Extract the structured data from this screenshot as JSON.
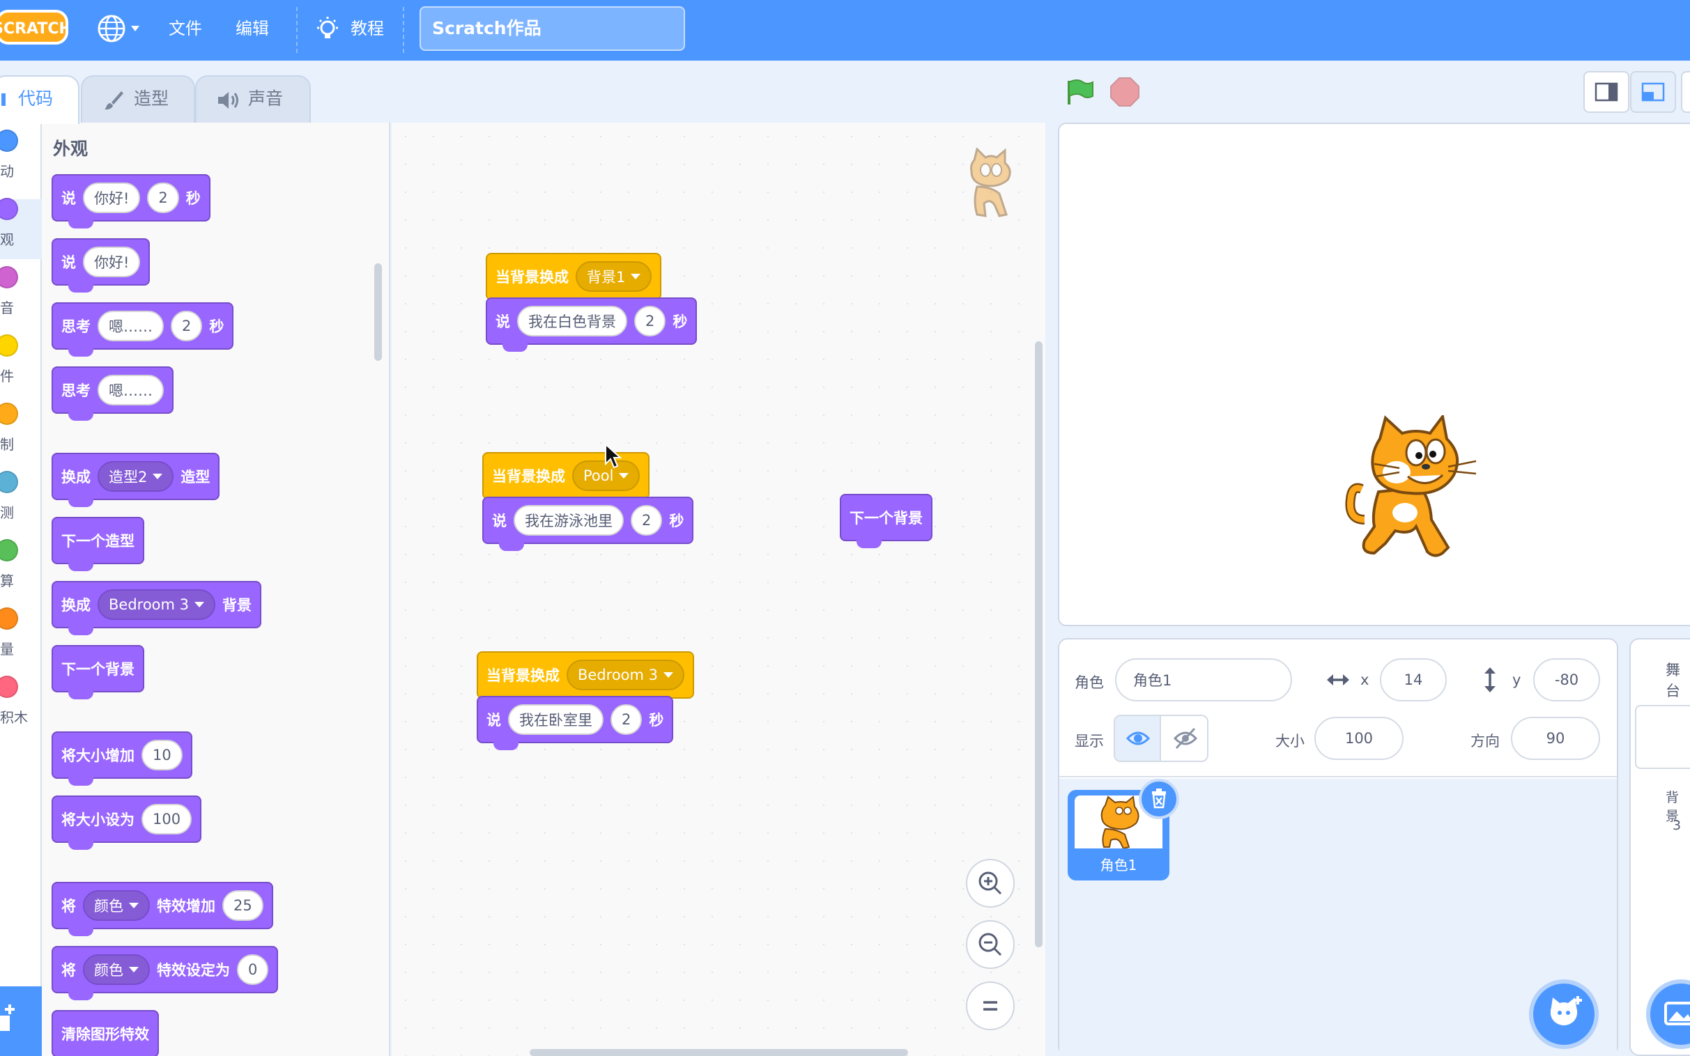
{
  "menubar": {
    "logo_text": "SCRATCH",
    "file": "文件",
    "edit": "编辑",
    "tutorials": "教程",
    "project_title": "Scratch作品"
  },
  "tabs": {
    "code": "代码",
    "costumes": "造型",
    "sounds": "声音"
  },
  "categories": [
    {
      "label": "动",
      "color": "#4c97ff"
    },
    {
      "label": "观",
      "color": "#9966ff"
    },
    {
      "label": "音",
      "color": "#cf63cf"
    },
    {
      "label": "件",
      "color": "#ffd500"
    },
    {
      "label": "制",
      "color": "#ffab19"
    },
    {
      "label": "测",
      "color": "#5cb1d6"
    },
    {
      "label": "算",
      "color": "#59c059"
    },
    {
      "label": "量",
      "color": "#ff8c1a"
    },
    {
      "label": "积木",
      "color": "#ff6680"
    }
  ],
  "palette": {
    "heading": "外观",
    "say_secs": {
      "say": "说",
      "msg": "你好!",
      "secs": "2",
      "unit": "秒"
    },
    "say": {
      "say": "说",
      "msg": "你好!"
    },
    "think_secs": {
      "think": "思考",
      "msg": "嗯……",
      "secs": "2",
      "unit": "秒"
    },
    "think": {
      "think": "思考",
      "msg": "嗯……"
    },
    "switch_costume": {
      "label": "换成",
      "value": "造型2",
      "suffix": "造型"
    },
    "next_costume": "下一个造型",
    "switch_backdrop": {
      "label": "换成",
      "value": "Bedroom 3",
      "suffix": "背景"
    },
    "next_backdrop": "下一个背景",
    "change_size": {
      "label": "将大小增加",
      "value": "10"
    },
    "set_size": {
      "label": "将大小设为",
      "value": "100"
    },
    "change_effect": {
      "prefix": "将",
      "effect": "颜色",
      "label": "特效增加",
      "value": "25"
    },
    "set_effect": {
      "prefix": "将",
      "effect": "颜色",
      "label": "特效设定为",
      "value": "0"
    },
    "clear_effects": "清除图形特效"
  },
  "scripts": [
    {
      "hat": "当背景换成",
      "backdrop": "背景1",
      "say": "说",
      "msg": "我在白色背景",
      "secs": "2",
      "unit": "秒"
    },
    {
      "hat": "当背景换成",
      "backdrop": "Pool",
      "say": "说",
      "msg": "我在游泳池里",
      "secs": "2",
      "unit": "秒"
    },
    {
      "hat": "当背景换成",
      "backdrop": "Bedroom 3",
      "say": "说",
      "msg": "我在卧室里",
      "secs": "2",
      "unit": "秒"
    }
  ],
  "loose_block": "下一个背景",
  "sprite_info": {
    "sprite_label": "角色",
    "sprite_name": "角色1",
    "x_label": "x",
    "x": "14",
    "y_label": "y",
    "y": "-80",
    "show_label": "显示",
    "size_label": "大小",
    "size": "100",
    "direction_label": "方向",
    "direction": "90"
  },
  "sprite_list": [
    {
      "name": "角色1"
    }
  ],
  "stage_panel": {
    "title": "舞台",
    "backdrops_label": "背景",
    "backdrop_count": "3"
  },
  "colors": {
    "menubar": "#4c97ff",
    "looks": "#9966ff",
    "events": "#ffbf00"
  }
}
